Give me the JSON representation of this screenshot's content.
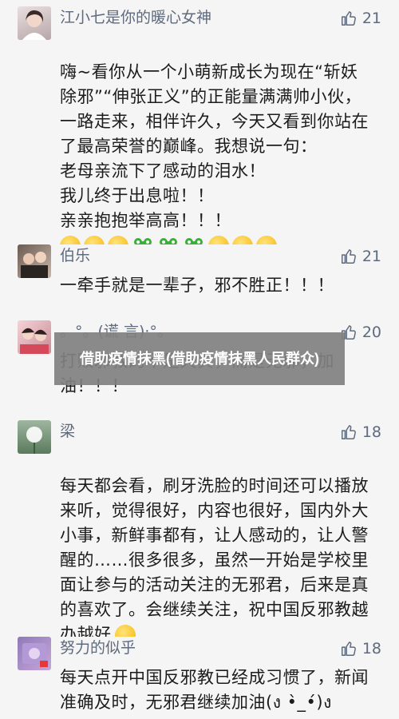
{
  "comments": [
    {
      "user": "江小七是你的暖心女神",
      "likes": "21",
      "text": "嗨~看你从一个小萌新成长为现在“斩妖除邪”“伸张正义”的正能量满满帅小伙，一路走来，相伴许久，今天又看到你站在了最高荣誉的巅峰。我想说一句：\n老母亲流下了感动的泪水！\n我儿终于出息啦！！\n亲亲抱抱举高高！！！",
      "emojis": [
        "kiss-face-emoji",
        "kiss-face-emoji",
        "kiss-face-emoji",
        "frog-emoji",
        "frog-emoji",
        "frog-emoji",
        "dizzy-face-emoji",
        "dizzy-face-emoji",
        "dizzy-face-emoji"
      ]
    },
    {
      "user": "伯乐",
      "likes": "21",
      "text": "一牵手就是一辈子，邪不胜正！！！"
    },
    {
      "user": "。°。(谎 言)·°。",
      "likes": "20",
      "text": "打败邪教的不是天真，而是无邪，加油！！！"
    },
    {
      "user": "梁",
      "likes": "18",
      "text": "每天都会看，刷牙洗脸的时间还可以播放来听，觉得很好，内容也很好，国内外大小事，新鲜事都有，让人感动的，让人警醒的……很多很多，虽然一开始是学校里面让参与的活动关注的无邪君，后来是真的喜欢了。会继续关注，祝中国反邪教越办越好",
      "emojis": [
        "smile-face-emoji"
      ]
    },
    {
      "user": "努力的似乎",
      "likes": "18",
      "text": "每天点开中国反邪教已经成习惯了，新闻准确及时，无邪君继续加油(ง •̀_•́)ง"
    }
  ],
  "overlay_title": "借助疫情抹黑(借助疫情抹黑人民群众)",
  "colors": {
    "name": "#5e6a7d",
    "background": "#f5f5f5",
    "overlay": "#808080"
  }
}
